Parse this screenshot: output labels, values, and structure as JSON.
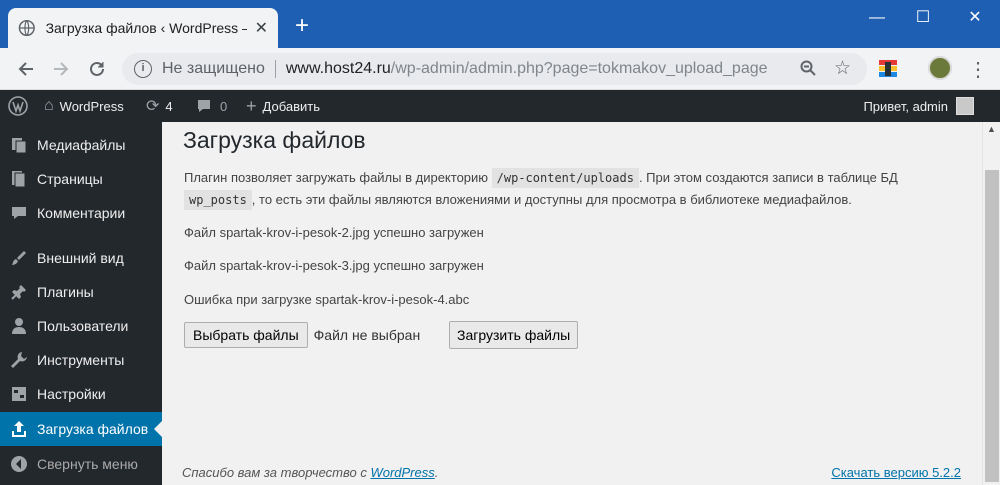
{
  "browser": {
    "tab_title": "Загрузка файлов ‹ WordPress —",
    "tab_close": "✕",
    "new_tab": "+",
    "minimize": "—",
    "maximize": "☐",
    "close": "✕",
    "security_label": "Не защищено",
    "url_host": "www.host24.ru",
    "url_path": "/wp-admin/admin.php?page=tokmakov_upload_page",
    "icons": [
      "back-icon",
      "forward-icon",
      "reload-icon",
      "info-icon",
      "zoom-icon",
      "star-icon",
      "extension-icon",
      "profile-icon",
      "menu-icon"
    ]
  },
  "adminbar": {
    "site_name": "WordPress",
    "updates_count": "4",
    "comments_count": "0",
    "add_new": "Добавить",
    "greeting": "Привет, admin"
  },
  "sidebar": {
    "items": [
      {
        "label": "Медиафайлы",
        "icon": "media-icon"
      },
      {
        "label": "Страницы",
        "icon": "pages-icon"
      },
      {
        "label": "Комментарии",
        "icon": "comments-icon"
      },
      {
        "label": "Внешний вид",
        "icon": "appearance-icon"
      },
      {
        "label": "Плагины",
        "icon": "plugins-icon"
      },
      {
        "label": "Пользователи",
        "icon": "users-icon"
      },
      {
        "label": "Инструменты",
        "icon": "tools-icon"
      },
      {
        "label": "Настройки",
        "icon": "settings-icon"
      },
      {
        "label": "Загрузка файлов",
        "icon": "upload-icon",
        "active": true
      },
      {
        "label": "Свернуть меню",
        "icon": "collapse-icon"
      }
    ]
  },
  "main": {
    "title": "Загрузка файлов",
    "desc_part1": "Плагин позволяет загружать файлы в директорию ",
    "desc_code1": "/wp-content/uploads",
    "desc_part2": ". При этом создаются записи в таблице БД ",
    "desc_code2": "wp_posts",
    "desc_part3": ", то есть эти файлы являются вложениями и доступны для просмотра в библиотеке медиафайлов.",
    "messages": [
      "Файл spartak-krov-i-pesok-2.jpg успешно загружен",
      "Файл spartak-krov-i-pesok-3.jpg успешно загружен",
      "Ошибка при загрузке spartak-krov-i-pesok-4.abc"
    ],
    "choose_files": "Выбрать файлы",
    "no_file": "Файл не выбран",
    "upload_button": "Загрузить файлы"
  },
  "footer": {
    "thanks_text": "Спасибо вам за творчество с ",
    "thanks_link": "WordPress",
    "thanks_end": ".",
    "version_link": "Скачать версию 5.2.2"
  },
  "colors": {
    "titlebar": "#1f5fb3",
    "admin_dark": "#23282d",
    "accent": "#0073aa",
    "content_bg": "#f1f1f1"
  }
}
